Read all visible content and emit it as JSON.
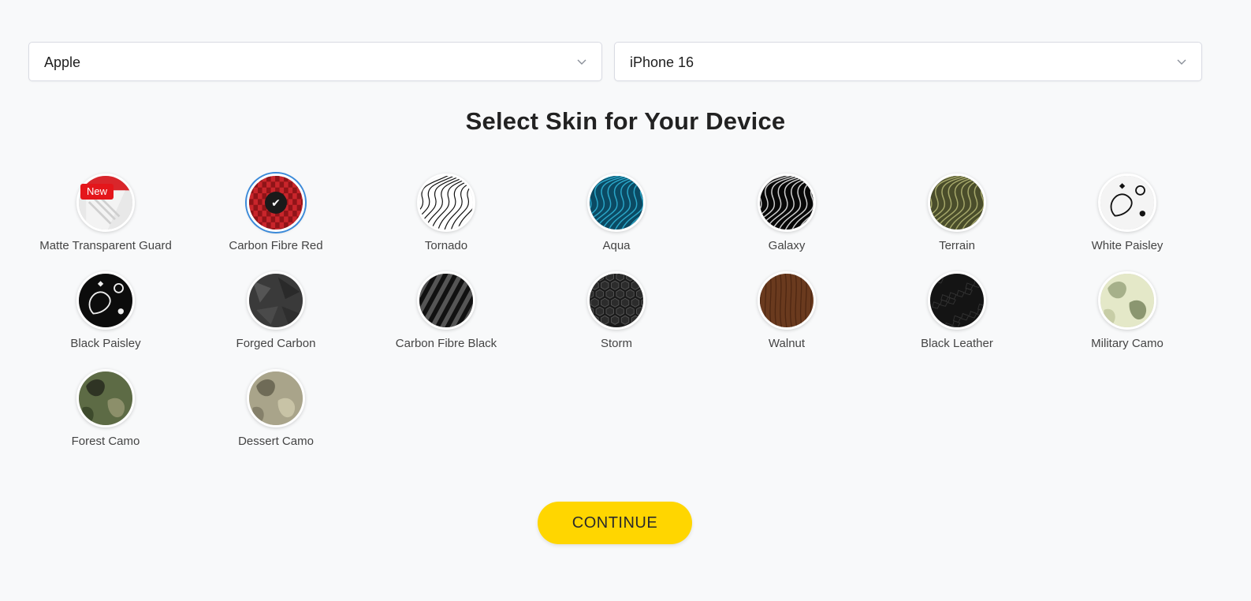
{
  "selectors": {
    "brand": "Apple",
    "model": "iPhone 16"
  },
  "title": "Select Skin for Your Device",
  "skins": [
    {
      "name": "Matte Transparent Guard",
      "pattern": "matte-transparent",
      "badge": "New",
      "selected": false
    },
    {
      "name": "Carbon Fibre Red",
      "pattern": "carbon-red",
      "selected": true
    },
    {
      "name": "Tornado",
      "pattern": "tornado-lines",
      "selected": false
    },
    {
      "name": "Aqua",
      "pattern": "aqua-waves",
      "selected": false
    },
    {
      "name": "Galaxy",
      "pattern": "galaxy-waves",
      "selected": false
    },
    {
      "name": "Terrain",
      "pattern": "terrain-waves",
      "selected": false
    },
    {
      "name": "White Paisley",
      "pattern": "white-paisley",
      "selected": false
    },
    {
      "name": "Black Paisley",
      "pattern": "black-paisley",
      "selected": false
    },
    {
      "name": "Forged Carbon",
      "pattern": "forged-carbon",
      "selected": false
    },
    {
      "name": "Carbon Fibre Black",
      "pattern": "carbon-black",
      "selected": false
    },
    {
      "name": "Storm",
      "pattern": "storm-hex",
      "selected": false
    },
    {
      "name": "Walnut",
      "pattern": "walnut-wood",
      "selected": false
    },
    {
      "name": "Black Leather",
      "pattern": "black-leather",
      "selected": false
    },
    {
      "name": "Military Camo",
      "pattern": "military-camo",
      "selected": false
    },
    {
      "name": "Forest Camo",
      "pattern": "forest-camo",
      "selected": false
    },
    {
      "name": "Dessert Camo",
      "pattern": "dessert-camo",
      "selected": false
    }
  ],
  "continue_label": "CONTINUE",
  "colors": {
    "accent": "#ffd600",
    "selected_ring": "#3b8ad9",
    "badge": "#e4161b"
  }
}
